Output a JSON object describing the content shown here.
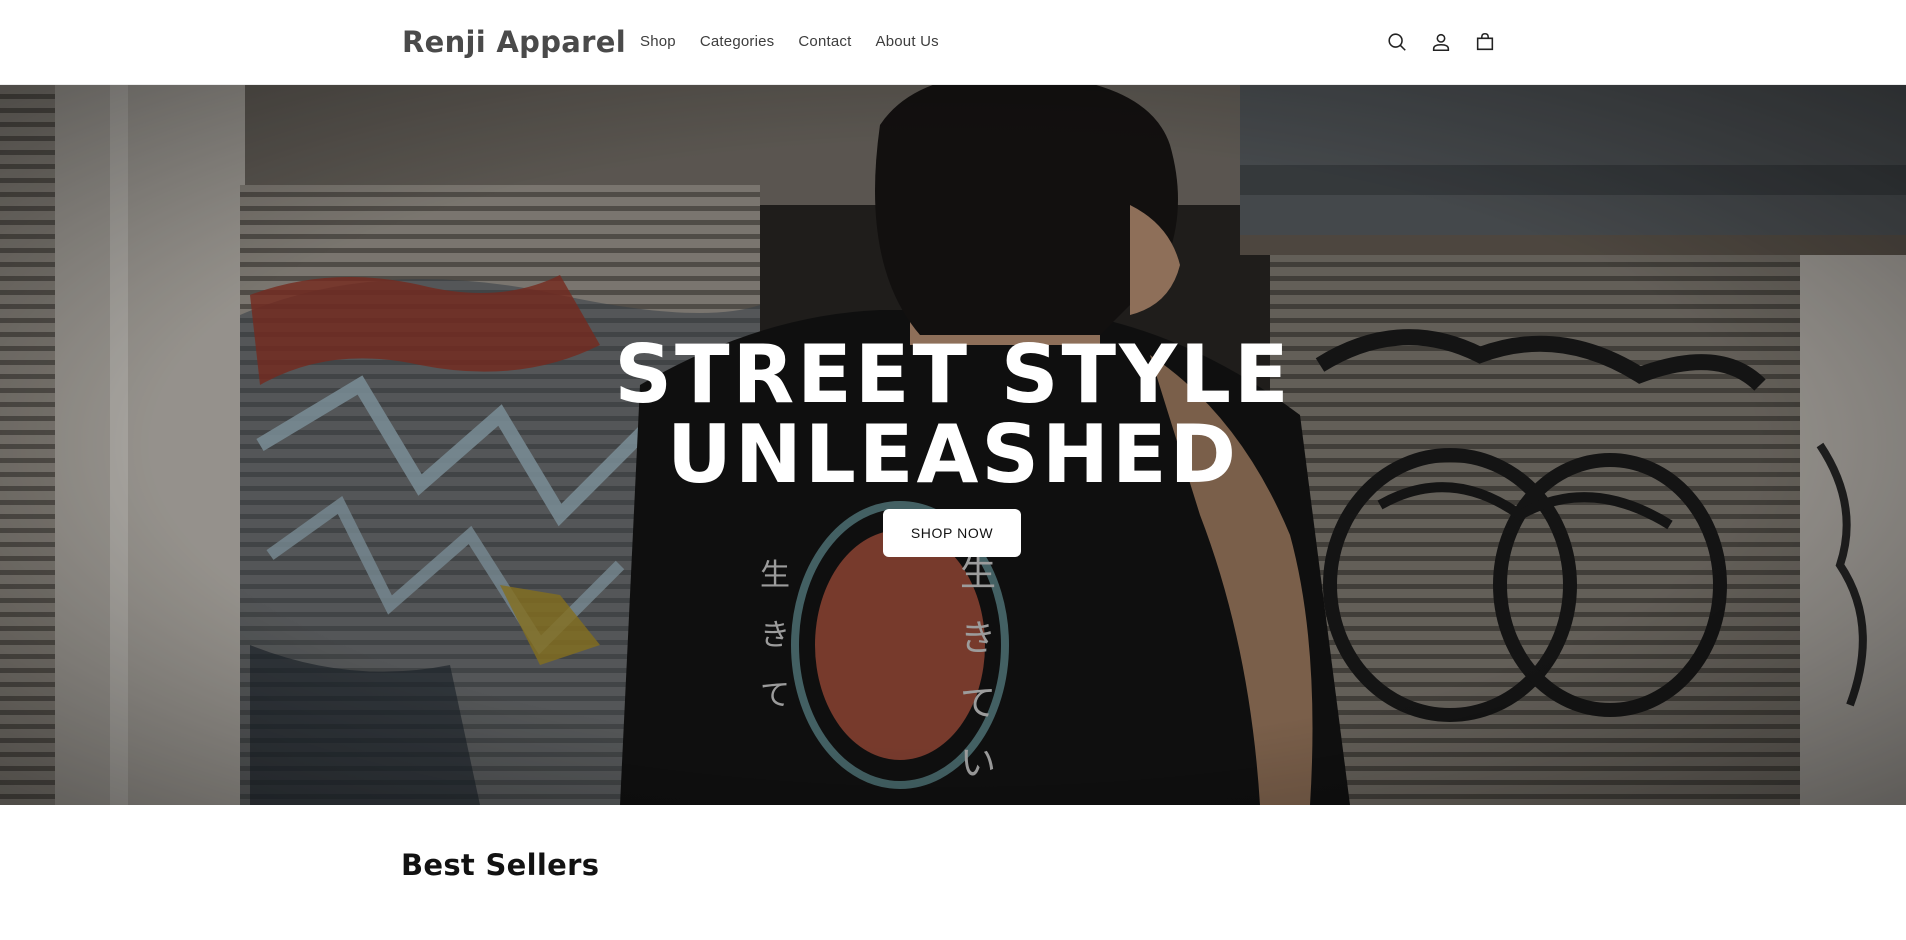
{
  "header": {
    "logo": "Renji Apparel",
    "nav": [
      "Shop",
      "Categories",
      "Contact",
      "About Us"
    ],
    "icons": [
      "search-icon",
      "account-icon",
      "cart-icon"
    ]
  },
  "hero": {
    "title_line1": "STREET STYLE",
    "title_line2": "UNLEASHED",
    "cta_label": "SHOP NOW"
  },
  "best_sellers": {
    "title": "Best Sellers"
  },
  "colors": {
    "text": "#121212",
    "hero_text": "#ffffff",
    "button_bg": "#ffffff"
  }
}
